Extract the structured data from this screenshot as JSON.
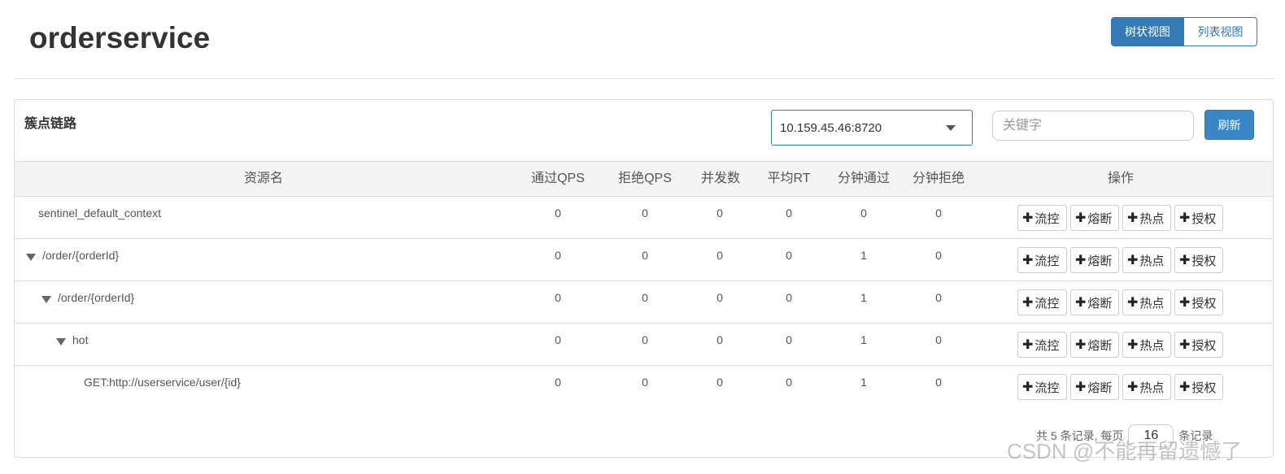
{
  "header": {
    "title": "orderservice",
    "view_tree": "树状视图",
    "view_list": "列表视图"
  },
  "panel": {
    "title": "簇点链路",
    "machine_selected": "10.159.45.46:8720",
    "keyword_placeholder": "关键字",
    "refresh_label": "刷新"
  },
  "table": {
    "columns": [
      "资源名",
      "通过QPS",
      "拒绝QPS",
      "并发数",
      "平均RT",
      "分钟通过",
      "分钟拒绝",
      "操作"
    ],
    "rows": [
      {
        "name": "sentinel_default_context",
        "values": [
          "0",
          "0",
          "0",
          "0",
          "0",
          "0"
        ]
      },
      {
        "name": "/order/{orderId}",
        "values": [
          "0",
          "0",
          "0",
          "0",
          "1",
          "0"
        ]
      },
      {
        "name": "/order/{orderId}",
        "values": [
          "0",
          "0",
          "0",
          "0",
          "1",
          "0"
        ]
      },
      {
        "name": "hot",
        "values": [
          "0",
          "0",
          "0",
          "0",
          "1",
          "0"
        ]
      },
      {
        "name": "GET:http://userservice/user/{id}",
        "values": [
          "0",
          "0",
          "0",
          "0",
          "1",
          "0"
        ]
      }
    ],
    "actions": [
      "流控",
      "熔断",
      "热点",
      "授权"
    ]
  },
  "pager": {
    "prefix": "共 5 条记录, 每页",
    "page_size": "16",
    "suffix": "条记录"
  },
  "watermark": "CSDN @不能再留遗憾了"
}
